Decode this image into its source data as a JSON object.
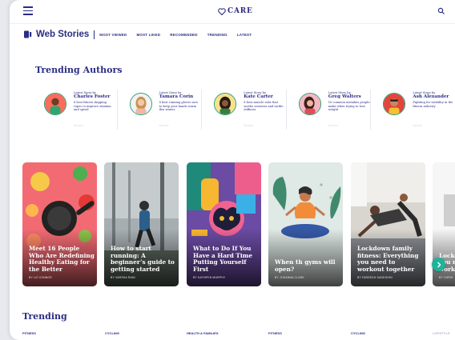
{
  "header": {
    "brand": "CARE"
  },
  "web_stories": {
    "title": "Web Stories",
    "nav": [
      "MOST VIEWED",
      "MOST LIKED",
      "RECOMENDED",
      "TRENDING",
      "LATEST"
    ]
  },
  "trending_authors": {
    "title": "Trending Authors",
    "authors": [
      {
        "label": "Latest Story by",
        "name": "Charles Foster",
        "desc": "8 best fitness skipping ropes to improve stamina and speed",
        "tag": "Workout"
      },
      {
        "label": "Latest Story by",
        "name": "Tamara Corin",
        "desc": "8 best running gloves sure to keep your hands warm this winter",
        "tag": "Workout"
      },
      {
        "label": "Latest Story by",
        "name": "Kate Carter",
        "desc": "8 best muscle rubs that soothe soreness and tackle stiffness",
        "tag": "Workout"
      },
      {
        "label": "Latest Story by",
        "name": "Greg Walters",
        "desc": "16 common mistakes people make when trying to lose weight",
        "tag": "Workout"
      },
      {
        "label": "Latest Story by",
        "name": "Ash Alexander",
        "desc": "Fighting for visibility in the fitness industry",
        "tag": "Workout"
      }
    ]
  },
  "stories": [
    {
      "title": "Meet 16 People Who Are Redefining Healthy Eating for the Better",
      "byline": "BY LIZ CONNOR"
    },
    {
      "title": "How to start running: A beginner’s guide to getting started",
      "byline": "BY VARSHA RANI"
    },
    {
      "title": "What to Do If You Have a Hard Time Putting Yourself First",
      "byline": "BY KATHRYN MURPHY"
    },
    {
      "title": "When th gyms will open?",
      "byline": "BY JOHANNA CLARK"
    },
    {
      "title": "Lockdown family fitness: Everything you need to workout together",
      "byline": "BY FAREEDH SADEGHIN"
    },
    {
      "title": "Lockdown fitness: you need to workout",
      "byline": "BY CHRIS"
    }
  ],
  "trending": {
    "title": "Trending",
    "categories": [
      "FITNESS",
      "CYCLING",
      "HEALTH & FAMILIES",
      "FITNESS",
      "CYCLING",
      "LIFESTYLE"
    ]
  },
  "colors": {
    "brand": "#2a2d83",
    "accent": "#20b39a",
    "avatar_ring": "#2f9b77"
  }
}
